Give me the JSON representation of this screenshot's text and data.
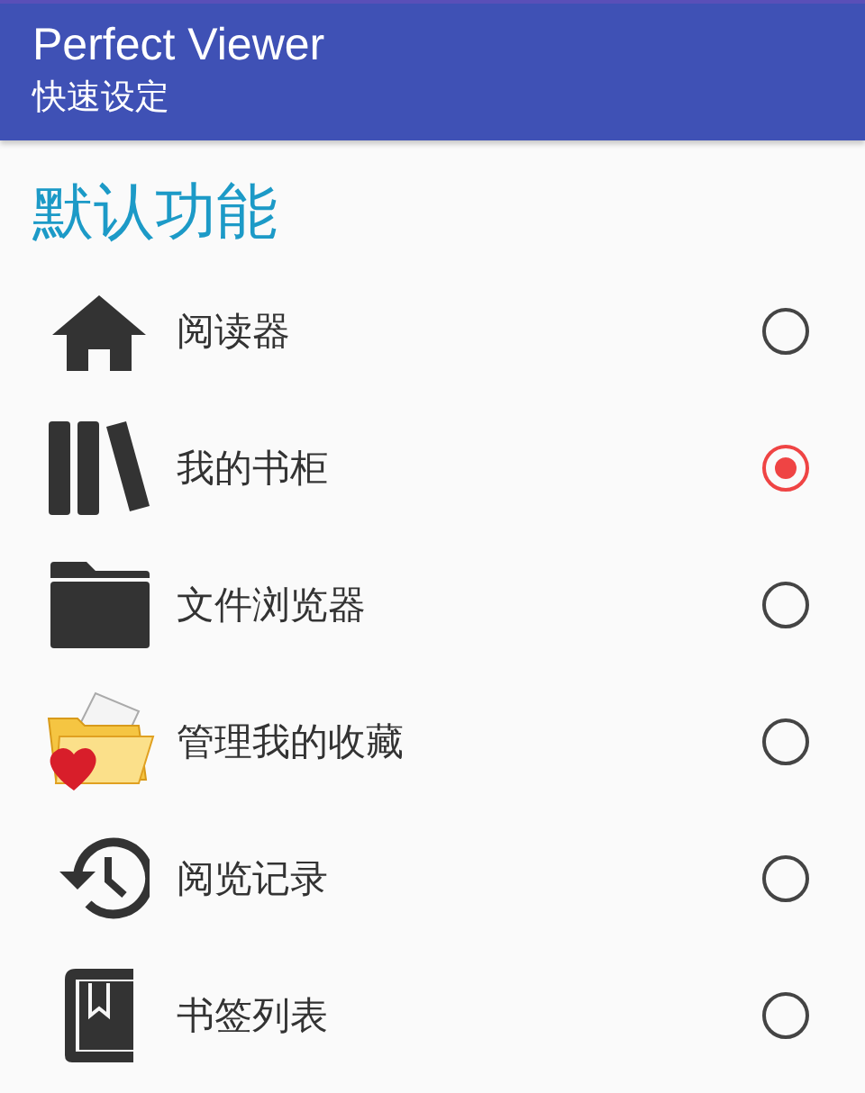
{
  "app_bar": {
    "title": "Perfect Viewer",
    "subtitle": "快速设定"
  },
  "section": {
    "title": "默认功能"
  },
  "options": [
    {
      "kind": "home",
      "label": "阅读器",
      "selected": false
    },
    {
      "kind": "shelf",
      "label": "我的书柜",
      "selected": true
    },
    {
      "kind": "folder",
      "label": "文件浏览器",
      "selected": false
    },
    {
      "kind": "favorites",
      "label": "管理我的收藏",
      "selected": false
    },
    {
      "kind": "history",
      "label": "阅览记录",
      "selected": false
    },
    {
      "kind": "bookmark",
      "label": "书签列表",
      "selected": false
    }
  ]
}
